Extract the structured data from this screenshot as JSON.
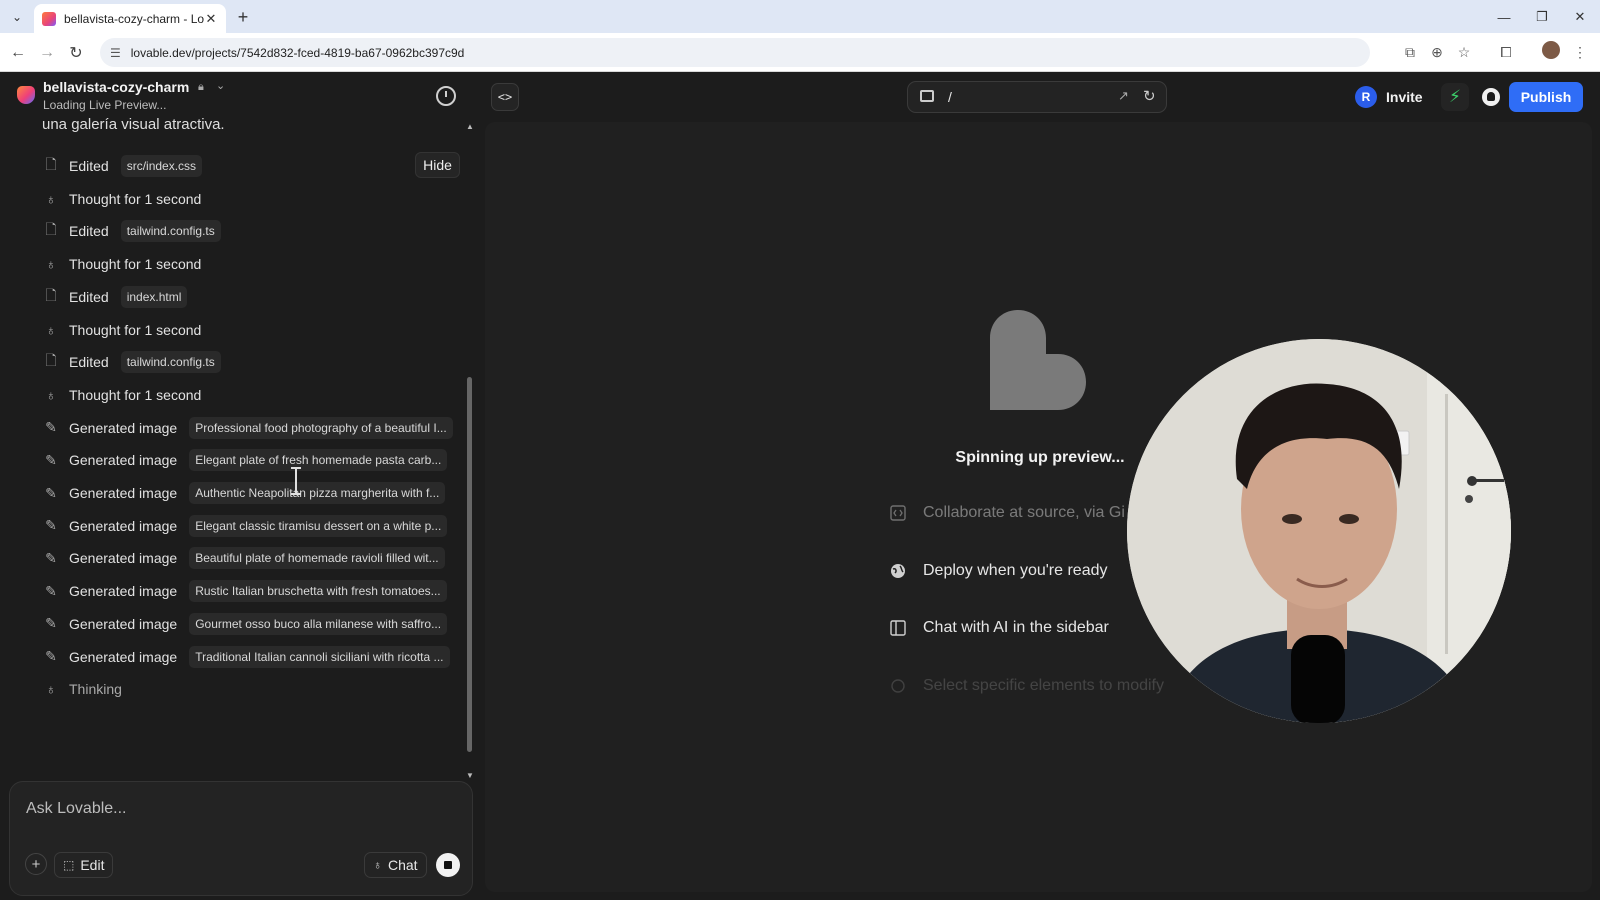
{
  "browser": {
    "tab_title": "bellavista-cozy-charm - Lovable",
    "url": "lovable.dev/projects/7542d832-fced-4819-ba67-0962bc397c9d"
  },
  "header": {
    "project_name": "bellavista-cozy-charm",
    "status": "Loading Live Preview...",
    "route_path": "/",
    "invite_avatar_letter": "R",
    "invite_label": "Invite",
    "publish_label": "Publish",
    "accent_color": "#2f6df6"
  },
  "chat": {
    "partial_message": "una galería visual atractiva.",
    "hide_label": "Hide",
    "items": [
      {
        "icon": "file-edit-icon",
        "label": "Edited",
        "chip": "src/index.css"
      },
      {
        "icon": "lightbulb-icon",
        "label": "Thought for 1 second",
        "chip": ""
      },
      {
        "icon": "file-edit-icon",
        "label": "Edited",
        "chip": "tailwind.config.ts"
      },
      {
        "icon": "lightbulb-icon",
        "label": "Thought for 1 second",
        "chip": ""
      },
      {
        "icon": "file-edit-icon",
        "label": "Edited",
        "chip": "index.html"
      },
      {
        "icon": "lightbulb-icon",
        "label": "Thought for 1 second",
        "chip": ""
      },
      {
        "icon": "file-edit-icon",
        "label": "Edited",
        "chip": "tailwind.config.ts"
      },
      {
        "icon": "lightbulb-icon",
        "label": "Thought for 1 second",
        "chip": ""
      },
      {
        "icon": "wand-icon",
        "label": "Generated image",
        "chip": "Professional food photography of a beautiful I..."
      },
      {
        "icon": "wand-icon",
        "label": "Generated image",
        "chip": "Elegant plate of fresh homemade pasta carb..."
      },
      {
        "icon": "wand-icon",
        "label": "Generated image",
        "chip": "Authentic Neapolitan pizza margherita with f..."
      },
      {
        "icon": "wand-icon",
        "label": "Generated image",
        "chip": "Elegant classic tiramisu dessert on a white p..."
      },
      {
        "icon": "wand-icon",
        "label": "Generated image",
        "chip": "Beautiful plate of homemade ravioli filled wit..."
      },
      {
        "icon": "wand-icon",
        "label": "Generated image",
        "chip": "Rustic Italian bruschetta with fresh tomatoes..."
      },
      {
        "icon": "wand-icon",
        "label": "Generated image",
        "chip": "Gourmet osso buco alla milanese with saffro..."
      },
      {
        "icon": "wand-icon",
        "label": "Generated image",
        "chip": "Traditional Italian cannoli siciliani with ricotta ..."
      },
      {
        "icon": "lightbulb-icon",
        "label": "Thinking",
        "chip": ""
      }
    ],
    "composer_placeholder": "Ask Lovable...",
    "edit_label": "Edit",
    "chat_label": "Chat"
  },
  "preview": {
    "spinning_text": "Spinning up preview...",
    "features": [
      {
        "icon": "code-icon",
        "label": "Collaborate at source, via Gi",
        "opacity": 0.45
      },
      {
        "icon": "globe-icon",
        "label": "Deploy when you're ready",
        "opacity": 1.0
      },
      {
        "icon": "sidebar-icon",
        "label": "Chat with AI in the sidebar",
        "opacity": 1.0
      },
      {
        "icon": "select-icon",
        "label": "Select specific elements to modify",
        "opacity": 0.18
      }
    ]
  }
}
